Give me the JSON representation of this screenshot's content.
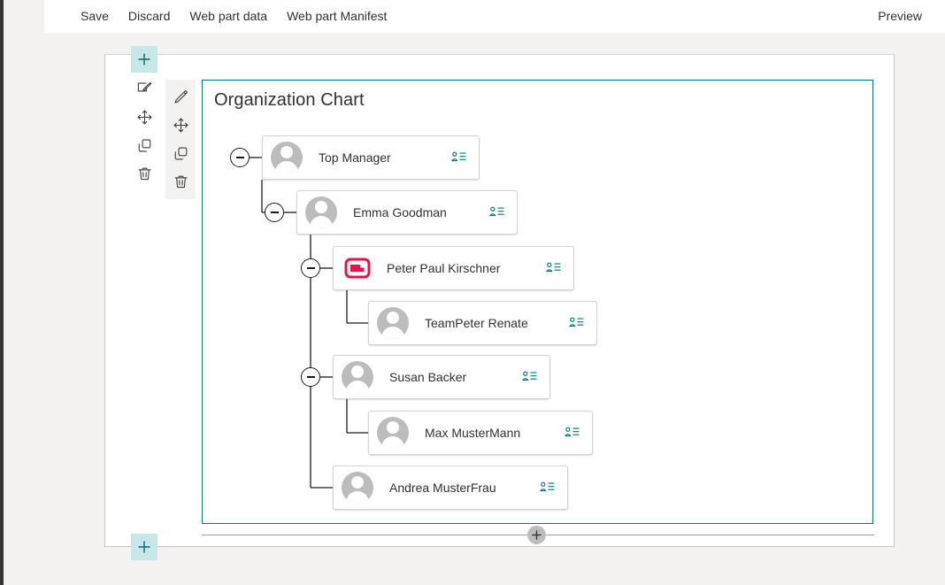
{
  "command_bar": {
    "left_buttons": [
      {
        "label": "Save",
        "name": "save-button"
      },
      {
        "label": "Discard",
        "name": "discard-button"
      },
      {
        "label": "Web part data",
        "name": "web-part-data-button"
      },
      {
        "label": "Web part Manifest",
        "name": "web-part-manifest-button"
      }
    ],
    "right_buttons": [
      {
        "label": "Preview",
        "name": "preview-button"
      }
    ]
  },
  "section_toolbar": {
    "add_label": "+",
    "tools": [
      {
        "icon": "edit-section-icon",
        "title": "Edit section"
      },
      {
        "icon": "move-section-icon",
        "title": "Move section"
      },
      {
        "icon": "duplicate-section-icon",
        "title": "Duplicate section"
      },
      {
        "icon": "delete-section-icon",
        "title": "Delete section"
      }
    ]
  },
  "webpart_toolbar": {
    "tools": [
      {
        "icon": "edit-web-part-icon",
        "title": "Edit web part"
      },
      {
        "icon": "move-web-part-icon",
        "title": "Move web part"
      },
      {
        "icon": "duplicate-web-part-icon",
        "title": "Duplicate web part"
      },
      {
        "icon": "delete-web-part-icon",
        "title": "Delete web part"
      }
    ]
  },
  "add_buttons": {
    "top_label": "+",
    "bottom_label": "+",
    "section_divider_label": "+"
  },
  "webpart": {
    "title": "Organization Chart",
    "accent_color": "#03787c",
    "broken_avatar_color": "#e8114b",
    "persona_icon_color": "#00747a",
    "org_chart": {
      "nodes": [
        {
          "id": "top-manager",
          "name": "Top Manager",
          "level": 0,
          "avatar": "person-avatar",
          "collapsed": false,
          "collapse_label": "−",
          "persona_icon": "person-details-icon"
        },
        {
          "id": "emma-goodman",
          "name": "Emma Goodman",
          "level": 1,
          "avatar": "person-avatar",
          "collapsed": false,
          "collapse_label": "−",
          "persona_icon": "person-details-icon"
        },
        {
          "id": "peter-paul-kirschner",
          "name": "Peter Paul Kirschner",
          "level": 2,
          "avatar": "broken-image-icon",
          "collapsed": false,
          "collapse_label": "−",
          "persona_icon": "person-details-icon"
        },
        {
          "id": "teampeter-renate",
          "name": "TeamPeter Renate",
          "level": 3,
          "avatar": "person-avatar",
          "collapsed": null,
          "collapse_label": "",
          "persona_icon": "person-details-icon"
        },
        {
          "id": "susan-backer",
          "name": "Susan Backer",
          "level": 2,
          "avatar": "person-avatar",
          "collapsed": false,
          "collapse_label": "−",
          "persona_icon": "person-details-icon"
        },
        {
          "id": "max-mustermann",
          "name": "Max MusterMann",
          "level": 3,
          "avatar": "person-avatar",
          "collapsed": null,
          "collapse_label": "",
          "persona_icon": "person-details-icon"
        },
        {
          "id": "andrea-musterfrau",
          "name": "Andrea MusterFrau",
          "level": 2,
          "avatar": "person-avatar",
          "collapsed": null,
          "collapse_label": "",
          "persona_icon": "person-details-icon"
        }
      ]
    }
  }
}
